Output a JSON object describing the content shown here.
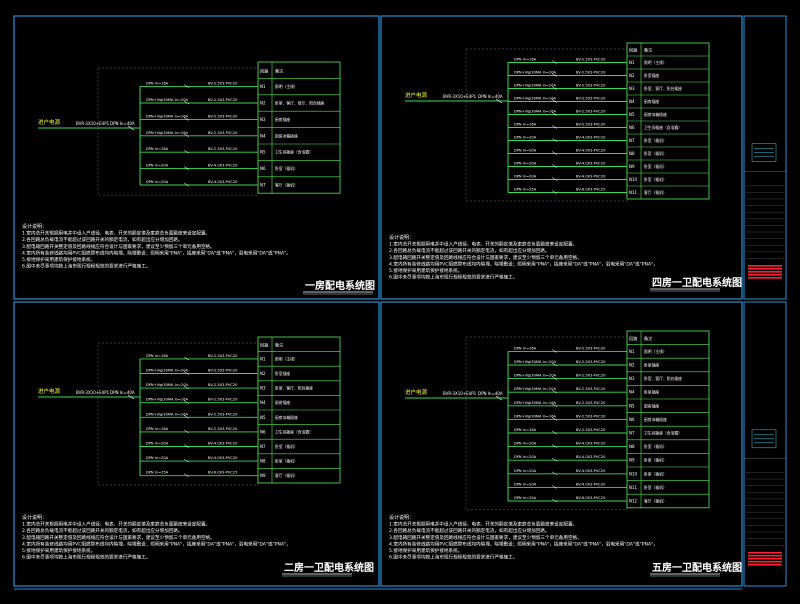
{
  "panels": [
    {
      "id": "p1",
      "title": "一房配电系统图",
      "incoming_label": "进户电源",
      "incoming_cable": "BVR-3X10+E4P1",
      "main_breaker": "DPN In=40A",
      "circuits": [
        {
          "breaker": "DPN In=16A",
          "cable": "BV-2.5X3-PVC20",
          "code": "N1",
          "desc": "照明（主线）"
        },
        {
          "breaker": "DPN+Vigi30MA In=20A",
          "cable": "BV-2.5X3-PVC20",
          "code": "N2",
          "desc": "卧室、客厅、餐厅、阳台插座"
        },
        {
          "breaker": "DPN+Vigi30MA In=16A",
          "cable": "BV-2.5X3-PVC20",
          "code": "N3",
          "desc": "厨房插座"
        },
        {
          "breaker": "DPN+Vigi30MA In=16A",
          "cable": "BV-2.5X3-PVC20",
          "code": "N4",
          "desc": "厨房冰箱插座"
        },
        {
          "breaker": "DPN In=16A",
          "cable": "BV-2.5X3-PVC20",
          "code": "N5",
          "desc": "卫生间插座（含浴霸）"
        },
        {
          "breaker": "DPN In=20A",
          "cable": "BV-4.0X3-PVC20",
          "code": "N6",
          "desc": "卧室（插机）"
        },
        {
          "breaker": "DPN In=20A",
          "cable": "BV-4.0X3-PVC20",
          "code": "N7",
          "desc": "客厅（插机）"
        }
      ]
    },
    {
      "id": "p2",
      "title": "四房一卫配电系统图",
      "incoming_label": "进户电源",
      "incoming_cable": "BVR-3X10+E4P1",
      "main_breaker": "DPN In=40A",
      "circuits": [
        {
          "breaker": "DPN In=16A",
          "cable": "BV-2.5X3-PVC20",
          "code": "N1",
          "desc": "照明（主线）"
        },
        {
          "breaker": "DPN+Vigi30MA In=20A",
          "cable": "BV-2.5X3-PVC20",
          "code": "N2",
          "desc": "卧室插座"
        },
        {
          "breaker": "DPN+Vigi30MA In=20A",
          "cable": "BV-2.5X3-PVC20",
          "code": "N3",
          "desc": "卧室、客厅、阳台插座"
        },
        {
          "breaker": "DPN+Vigi30MA In=16A",
          "cable": "BV-2.5X3-PVC20",
          "code": "N4",
          "desc": "厨房插座"
        },
        {
          "breaker": "DPN+Vigi30MA In=16A",
          "cable": "BV-2.5X3-PVC20",
          "code": "N5",
          "desc": "厨房冰箱插座"
        },
        {
          "breaker": "DPN In=16A",
          "cable": "BV-2.5X3-PVC20",
          "code": "N6",
          "desc": "卫生间插座（含浴霸）"
        },
        {
          "breaker": "DPN In=20A",
          "cable": "BV-4.0X3-PVC20",
          "code": "N7",
          "desc": "卧室（插机）"
        },
        {
          "breaker": "DPN In=20A",
          "cable": "BV-4.0X3-PVC20",
          "code": "N8",
          "desc": "卧室（插机）"
        },
        {
          "breaker": "DPN In=20A",
          "cable": "BV-4.0X3-PVC20",
          "code": "N9",
          "desc": "卧室（插机）"
        },
        {
          "breaker": "DPN In=20A",
          "cable": "BV-4.0X3-PVC20",
          "code": "N10",
          "desc": "卧室（插机）"
        },
        {
          "breaker": "DPN In=25A",
          "cable": "BV-6.0X3-PVC25",
          "code": "N11",
          "desc": "客厅（插机）"
        }
      ]
    },
    {
      "id": "p3",
      "title": "二房一卫配电系统图",
      "incoming_label": "进户电源",
      "incoming_cable": "BVR-3X10+E4P1",
      "main_breaker": "DPN In=40A",
      "circuits": [
        {
          "breaker": "DPN In=16A",
          "cable": "BV-2.5X3-PVC20",
          "code": "N1",
          "desc": "照明（主线）"
        },
        {
          "breaker": "DPN+Vigi30MA In=20A",
          "cable": "BV-2.5X3-PVC20",
          "code": "N2",
          "desc": "卧室插座"
        },
        {
          "breaker": "DPN+Vigi30MA In=20A",
          "cable": "BV-2.5X3-PVC20",
          "code": "N3",
          "desc": "卧室、客厅、阳台插座"
        },
        {
          "breaker": "DPN+Vigi30MA In=16A",
          "cable": "BV-2.5X3-PVC20",
          "code": "N4",
          "desc": "厨房插座"
        },
        {
          "breaker": "DPN+Vigi30MA In=16A",
          "cable": "BV-2.5X3-PVC20",
          "code": "N5",
          "desc": "厨房冰箱插座"
        },
        {
          "breaker": "DPN In=16A",
          "cable": "BV-2.5X3-PVC20",
          "code": "N6",
          "desc": "卫生间插座（含浴霸）"
        },
        {
          "breaker": "DPN In=20A",
          "cable": "BV-4.0X3-PVC20",
          "code": "N7",
          "desc": "卧室（插机）"
        },
        {
          "breaker": "DPN In=20A",
          "cable": "BV-4.0X3-PVC20",
          "code": "N8",
          "desc": "卧室（插机）"
        },
        {
          "breaker": "DPN In=25A",
          "cable": "BV-6.0X3-PVC25",
          "code": "N9",
          "desc": "客厅（插机）"
        }
      ]
    },
    {
      "id": "p4",
      "title": "五房一卫配电系统图",
      "incoming_label": "进户电源",
      "incoming_cable": "BVR-3X10+E4P1",
      "main_breaker": "DPN In=40A",
      "circuits": [
        {
          "breaker": "DPN In=16A",
          "cable": "BV-2.5X3-PVC20",
          "code": "N1",
          "desc": "照明（主线）"
        },
        {
          "breaker": "DPN+Vigi30MA In=20A",
          "cable": "BV-2.5X3-PVC20",
          "code": "N2",
          "desc": "卧室插座"
        },
        {
          "breaker": "DPN+Vigi30MA In=20A",
          "cable": "BV-2.5X3-PVC20",
          "code": "N3",
          "desc": "卧室、客厅、阳台插座"
        },
        {
          "breaker": "DPN+Vigi30MA In=20A",
          "cable": "BV-2.5X3-PVC20",
          "code": "N4",
          "desc": "卧室插座"
        },
        {
          "breaker": "DPN+Vigi30MA In=16A",
          "cable": "BV-2.5X3-PVC20",
          "code": "N5",
          "desc": "厨房插座"
        },
        {
          "breaker": "DPN+Vigi30MA In=16A",
          "cable": "BV-2.5X3-PVC20",
          "code": "N6",
          "desc": "厨房冰箱插座"
        },
        {
          "breaker": "DPN In=16A",
          "cable": "BV-2.5X3-PVC20",
          "code": "N7",
          "desc": "卫生间插座（含浴霸）"
        },
        {
          "breaker": "DPN In=20A",
          "cable": "BV-4.0X3-PVC20",
          "code": "N8",
          "desc": "卧室（插机）"
        },
        {
          "breaker": "DPN In=20A",
          "cable": "BV-4.0X3-PVC20",
          "code": "N9",
          "desc": "卧室（插机）"
        },
        {
          "breaker": "DPN In=20A",
          "cable": "BV-4.0X3-PVC20",
          "code": "N10",
          "desc": "卧室（插机）"
        },
        {
          "breaker": "DPN In=20A",
          "cable": "BV-4.0X3-PVC20",
          "code": "N11",
          "desc": "卧室（插机）"
        },
        {
          "breaker": "DPN In=25A",
          "cable": "BV-6.0X3-PVC25",
          "code": "N12",
          "desc": "客厅（插机）"
        }
      ]
    }
  ],
  "table_header": {
    "code": "回路",
    "desc": "备注"
  },
  "notes": {
    "heading": "设计说明：",
    "lines": [
      "1.室内总开关根据用电并中设入户线径、电表、开关的额定值及家庭总负载额度来设定配置。",
      "2.各回路总负载电流不能超过该回路开关的额定电流，如有超出应分增加回路。",
      "3.配电箱回路开关整定值及回路线规应符合设计与国家要求，建议至少预留三个单元备用空格。",
      "4.室内所有装修线路均用PVC阻燃管布线均内暗埋，暗埋敷设；照明采用\"PNA\"，插座采用\"DA\"或\"PNA\"，弱电采用\"DA\"或\"PNA\"。",
      "5.接地保护采用建筑保护接地系统。",
      "6.图中未尽事项均按上海市现行规程规范的要求进行严格施工。"
    ]
  },
  "colors": {
    "background": "#000000",
    "frame": "#2a8fd6",
    "wire": "#33dd55",
    "table": "#55ee55",
    "text": "#ffffff",
    "label_yellow": "#ffff44",
    "accent_red": "#ff2233"
  }
}
